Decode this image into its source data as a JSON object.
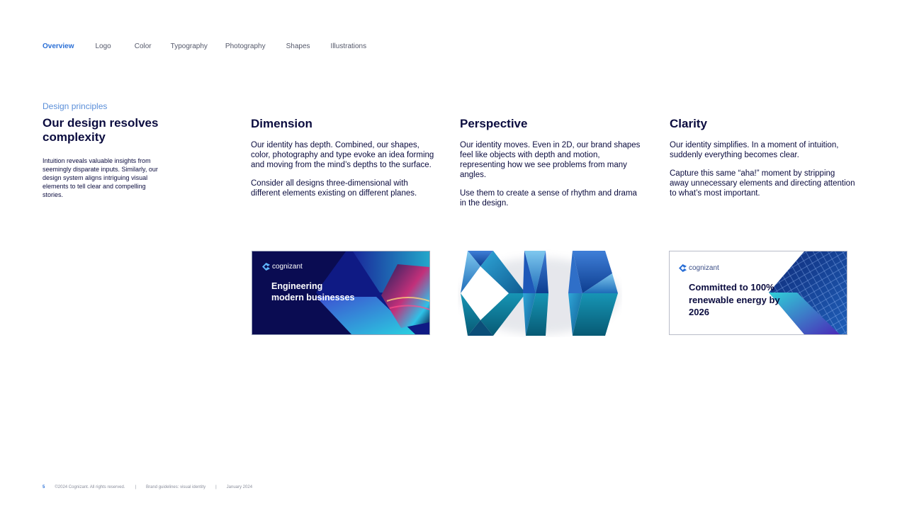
{
  "nav": {
    "items": [
      "Overview",
      "Logo",
      "Color",
      "Typography",
      "Photography",
      "Shapes",
      "Illustrations"
    ],
    "active": "Overview"
  },
  "intro": {
    "eyebrow": "Design principles",
    "title": "Our design resolves complexity",
    "body": "Intuition reveals valuable insights from seemingly disparate inputs. Similarly, our design system aligns intriguing visual elements to tell clear and compelling stories."
  },
  "principles": [
    {
      "title": "Dimension",
      "p1": "Our identity has depth. Combined, our shapes, color, photography and type evoke an idea forming and moving from the mind’s depths to the surface.",
      "p2": "Consider all designs three-dimensional with different elements existing on different planes."
    },
    {
      "title": "Perspective",
      "p1": "Our identity moves. Even in 2D, our brand shapes feel like objects with depth and motion, representing how we see problems from many angles.",
      "p2": "Use them to create a sense of rhythm and drama in the design."
    },
    {
      "title": "Clarity",
      "p1": "Our identity simplifies. In a moment of intuition, suddenly everything becomes clear.",
      "p2": "Capture this same “aha!” moment by stripping away unnecessary elements and directing attention to what’s most important."
    }
  ],
  "cards": {
    "dimension": {
      "brand": "cognizant",
      "headline": "Engineering modern businesses",
      "icon": "cognizant-logo-icon"
    },
    "clarity": {
      "brand": "cognizant",
      "headline": "Committed to 100% renewable energy by 2026",
      "icon": "cognizant-logo-icon"
    }
  },
  "footer": {
    "page_number": "5",
    "copyright": "©2024 Cognizant. All rights reserved.",
    "doc": "Brand guidelines: visual identity",
    "date": "January 2024",
    "separator": "|"
  },
  "colors": {
    "navy": "#0b0c3f",
    "accent_blue": "#2a6fd6",
    "eyebrow_blue": "#5b8fd9",
    "card_navy": "#0a0c52"
  }
}
